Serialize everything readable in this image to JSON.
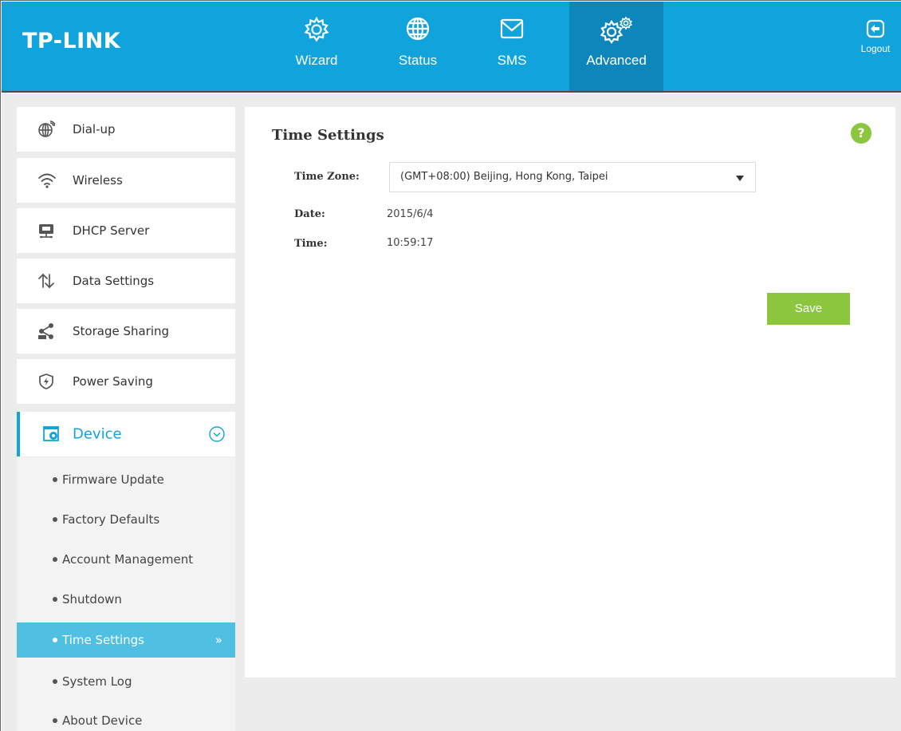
{
  "brand": {
    "logo": "TP-LINK"
  },
  "nav": {
    "items": [
      {
        "label": "Wizard",
        "icon": "gear-icon"
      },
      {
        "label": "Status",
        "icon": "globe-icon"
      },
      {
        "label": "SMS",
        "icon": "envelope-icon"
      },
      {
        "label": "Advanced",
        "icon": "gears-icon",
        "active": true
      }
    ],
    "logout": "Logout"
  },
  "sidebar": {
    "items": [
      {
        "label": "Dial-up",
        "icon": "globe-icon"
      },
      {
        "label": "Wireless",
        "icon": "wifi-icon"
      },
      {
        "label": "DHCP Server",
        "icon": "server-icon"
      },
      {
        "label": "Data Settings",
        "icon": "up-down-arrows-icon"
      },
      {
        "label": "Storage Sharing",
        "icon": "share-icon"
      },
      {
        "label": "Power Saving",
        "icon": "power-shield-icon"
      }
    ],
    "device": {
      "label": "Device",
      "icon": "device-settings-icon"
    },
    "device_sub": [
      {
        "label": "Firmware Update"
      },
      {
        "label": "Factory Defaults"
      },
      {
        "label": "Account Management"
      },
      {
        "label": "Shutdown"
      },
      {
        "label": "Time Settings",
        "active": true
      },
      {
        "label": "System Log"
      },
      {
        "label": "About Device"
      }
    ],
    "active_arrow": "»"
  },
  "panel": {
    "title": "Time Settings",
    "help": "?",
    "time_zone_label": "Time Zone:",
    "time_zone_value": "(GMT+08:00) Beijing, Hong Kong, Taipei",
    "date_label": "Date:",
    "date_value": "2015/6/4",
    "time_label": "Time:",
    "time_value": "10:59:17",
    "save_label": "Save"
  },
  "colors": {
    "header": "#10a3dc",
    "active_nav": "#0d86bc",
    "accent_green": "#8cc63f",
    "active_sub": "#4fbfe2"
  }
}
